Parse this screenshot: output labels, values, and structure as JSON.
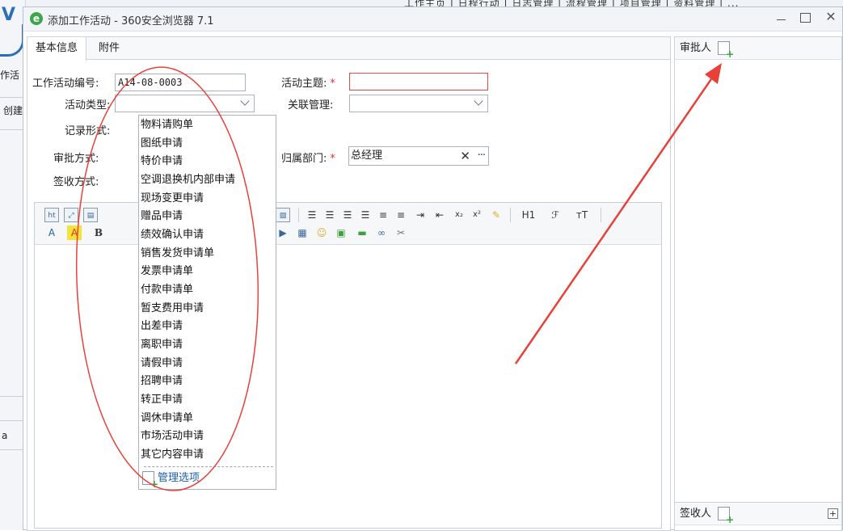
{
  "background": {
    "left_fragments": [
      "作活",
      "创建",
      "a"
    ],
    "top_menu": "工作主页  |  日程行动  |  日志管理  |  流程管理  |  项目管理  |  资料管理  |  ..."
  },
  "window": {
    "title": "添加工作活动 - 360安全浏览器 7.1",
    "controls": {
      "min": "—",
      "max": "□",
      "close": "✕"
    }
  },
  "tabs": [
    {
      "label": "基本信息",
      "active": true
    },
    {
      "label": "附件",
      "active": false
    }
  ],
  "form": {
    "code_label": "工作活动编号:",
    "code_value": "A14-08-0003",
    "subject_label": "活动主题:",
    "subject_required": "*",
    "subject_value": "",
    "type_label": "活动类型:",
    "type_value": "",
    "related_label": "关联管理:",
    "related_value": "",
    "record_label": "记录形式:",
    "approve_mode_label": "审批方式:",
    "sign_mode_label": "签收方式:",
    "dept_label": "归属部门:",
    "dept_required": "*",
    "dept_value": "总经理",
    "dept_clear": "✕",
    "dept_browse": "···"
  },
  "dropdown": {
    "options": [
      "物料请购单",
      "图纸申请",
      "特价申请",
      "空调退换机内部申请",
      "现场变更申请",
      "赠品申请",
      "绩效确认申请",
      "销售发货申请单",
      "发票申请单",
      "付款申请单",
      "暂支费用申请",
      "出差申请",
      "离职申请",
      "请假申请",
      "招聘申请",
      "转正申请",
      "调休申请单",
      "市场活动申请",
      "其它内容申请"
    ],
    "manage_label": "管理选项"
  },
  "toolbar": {
    "row1_tail": [
      "H1",
      "ℱ",
      "ᴛT"
    ],
    "row2_head": [
      "A",
      "A",
      "B"
    ],
    "sub": "x₂",
    "sup": "x²"
  },
  "approver": {
    "title": "审批人"
  },
  "receiver": {
    "title": "签收人",
    "plus": "+"
  },
  "colors": {
    "annotation": "#e8413a",
    "link": "#1d5fb0",
    "required": "#e03333"
  }
}
